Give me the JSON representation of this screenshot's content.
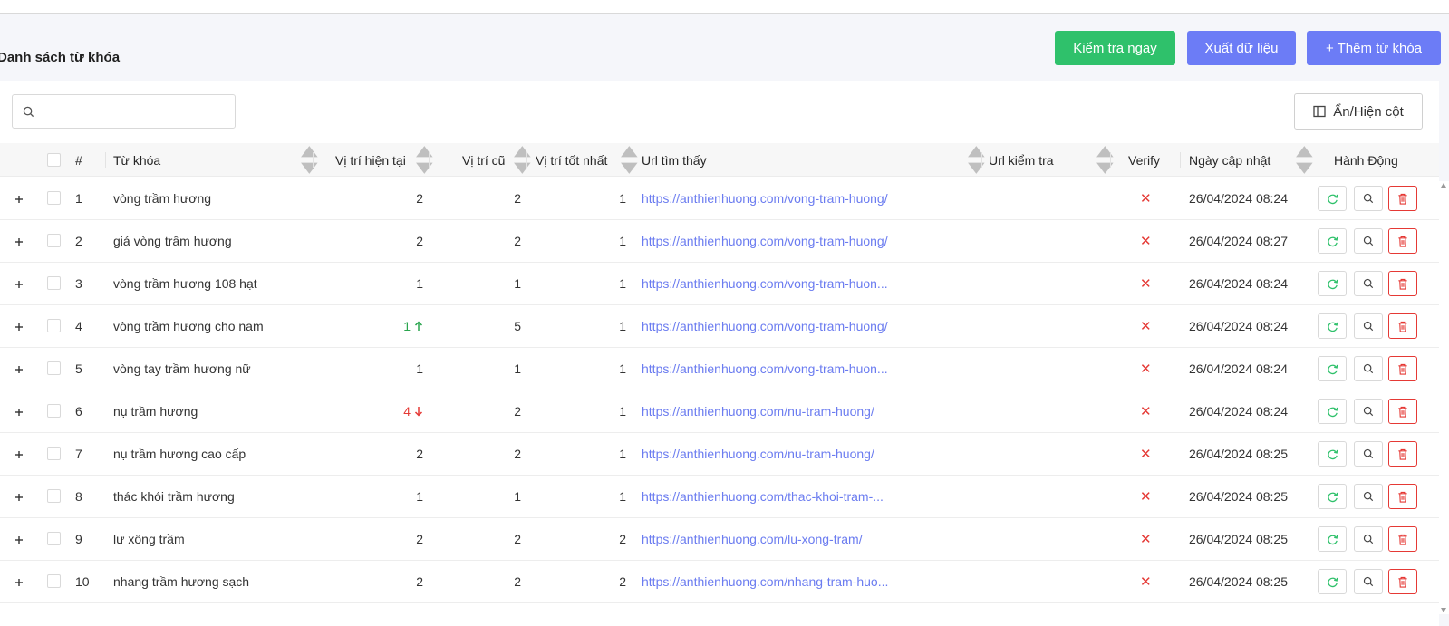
{
  "page": {
    "title": "Danh sách từ khóa",
    "buttons": {
      "check_now": "Kiểm tra ngay",
      "export": "Xuất dữ liệu",
      "add_keyword": "+ Thêm từ khóa"
    },
    "toggle_columns": "Ẩn/Hiện cột",
    "search": {
      "value": "",
      "placeholder": ""
    }
  },
  "colors": {
    "green": "#2fc16b",
    "primary": "#6c7cf6",
    "link": "#6b7cf0",
    "danger": "#e53935",
    "up": "#2aa54e"
  },
  "table": {
    "headers": {
      "index": "#",
      "keyword": "Từ khóa",
      "current_pos": "Vị trí hiện tại",
      "old_pos": "Vị trí cũ",
      "best_pos": "Vị trí tốt nhất",
      "url_found": "Url tìm thấy",
      "url_check": "Url kiểm tra",
      "verify": "Verify",
      "updated": "Ngày cập nhật",
      "actions": "Hành Động"
    },
    "rows": [
      {
        "idx": "1",
        "keyword": "vòng trầm hương",
        "current": "2",
        "trend": "",
        "old": "2",
        "best": "1",
        "url": "https://anthienhuong.com/vong-tram-huong/",
        "verify": "✕",
        "updated": "26/04/2024 08:24"
      },
      {
        "idx": "2",
        "keyword": "giá vòng trầm hương",
        "current": "2",
        "trend": "",
        "old": "2",
        "best": "1",
        "url": "https://anthienhuong.com/vong-tram-huong/",
        "verify": "✕",
        "updated": "26/04/2024 08:27"
      },
      {
        "idx": "3",
        "keyword": "vòng trầm hương 108 hạt",
        "current": "1",
        "trend": "",
        "old": "1",
        "best": "1",
        "url": "https://anthienhuong.com/vong-tram-huon...",
        "verify": "✕",
        "updated": "26/04/2024 08:24"
      },
      {
        "idx": "4",
        "keyword": "vòng trầm hương cho nam",
        "current": "1",
        "trend": "up",
        "old": "5",
        "best": "1",
        "url": "https://anthienhuong.com/vong-tram-huong/",
        "verify": "✕",
        "updated": "26/04/2024 08:24"
      },
      {
        "idx": "5",
        "keyword": "vòng tay trầm hương nữ",
        "current": "1",
        "trend": "",
        "old": "1",
        "best": "1",
        "url": "https://anthienhuong.com/vong-tram-huon...",
        "verify": "✕",
        "updated": "26/04/2024 08:24"
      },
      {
        "idx": "6",
        "keyword": "nụ trầm hương",
        "current": "4",
        "trend": "down",
        "old": "2",
        "best": "1",
        "url": "https://anthienhuong.com/nu-tram-huong/",
        "verify": "✕",
        "updated": "26/04/2024 08:24"
      },
      {
        "idx": "7",
        "keyword": "nụ trầm hương cao cấp",
        "current": "2",
        "trend": "",
        "old": "2",
        "best": "1",
        "url": "https://anthienhuong.com/nu-tram-huong/",
        "verify": "✕",
        "updated": "26/04/2024 08:25"
      },
      {
        "idx": "8",
        "keyword": "thác khói trầm hương",
        "current": "1",
        "trend": "",
        "old": "1",
        "best": "1",
        "url": "https://anthienhuong.com/thac-khoi-tram-...",
        "verify": "✕",
        "updated": "26/04/2024 08:25"
      },
      {
        "idx": "9",
        "keyword": "lư xông trầm",
        "current": "2",
        "trend": "",
        "old": "2",
        "best": "2",
        "url": "https://anthienhuong.com/lu-xong-tram/",
        "verify": "✕",
        "updated": "26/04/2024 08:25"
      },
      {
        "idx": "10",
        "keyword": "nhang trầm hương sạch",
        "current": "2",
        "trend": "",
        "old": "2",
        "best": "2",
        "url": "https://anthienhuong.com/nhang-tram-huo...",
        "verify": "✕",
        "updated": "26/04/2024 08:25"
      }
    ]
  }
}
